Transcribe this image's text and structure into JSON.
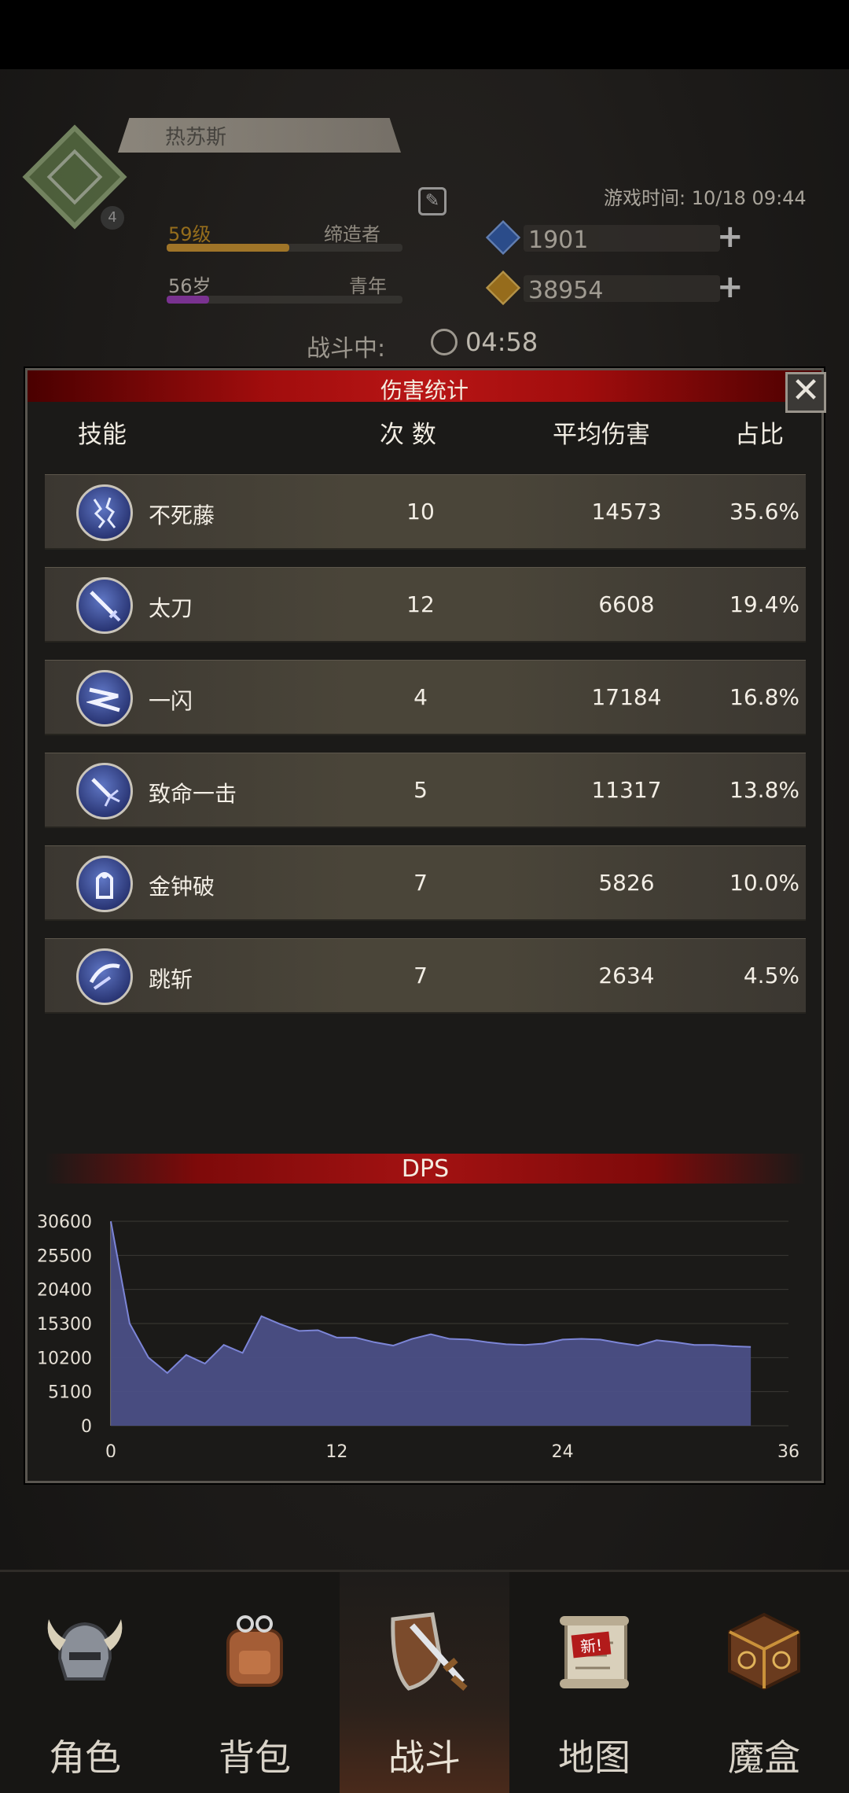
{
  "header": {
    "player_name": "热苏斯",
    "level_text": "59级",
    "title_text": "缔造者",
    "age_text": "56岁",
    "age_stage": "青年",
    "game_time_label": "游戏时间:",
    "game_time_value": "10/18 09:44",
    "gems": "1901",
    "gold": "38954",
    "battle_label": "战斗中:",
    "battle_timer": "04:58",
    "emblem_badge": "4"
  },
  "modal": {
    "title": "伤害统计",
    "close_glyph": "✕",
    "columns": {
      "skill": "技能",
      "count": "次 数",
      "avg": "平均伤害",
      "ratio": "占比"
    },
    "rows": [
      {
        "name": "不死藤",
        "count": "10",
        "avg": "14573",
        "ratio": "35.6%",
        "icon": "vine-lightning-icon"
      },
      {
        "name": "太刀",
        "count": "12",
        "avg": "6608",
        "ratio": "19.4%",
        "icon": "katana-icon"
      },
      {
        "name": "一闪",
        "count": "4",
        "avg": "17184",
        "ratio": "16.8%",
        "icon": "flash-strike-icon"
      },
      {
        "name": "致命一击",
        "count": "5",
        "avg": "11317",
        "ratio": "13.8%",
        "icon": "critical-strike-icon"
      },
      {
        "name": "金钟破",
        "count": "7",
        "avg": "5826",
        "ratio": "10.0%",
        "icon": "golden-bell-break-icon"
      },
      {
        "name": "跳斩",
        "count": "7",
        "avg": "2634",
        "ratio": "4.5%",
        "icon": "leap-slash-icon"
      }
    ],
    "dps_title": "DPS"
  },
  "chart_data": {
    "type": "area",
    "title": "DPS",
    "xlabel": "",
    "ylabel": "",
    "xlim": [
      0,
      36
    ],
    "ylim": [
      0,
      30600
    ],
    "x_ticks": [
      0,
      12,
      24,
      36
    ],
    "y_ticks": [
      0,
      5100,
      10200,
      15300,
      20400,
      25500,
      30600
    ],
    "grid": true,
    "series": [
      {
        "color": "#4b4f86",
        "x": [
          0,
          1,
          2,
          3,
          4,
          5,
          6,
          7,
          8,
          9,
          10,
          11,
          12,
          13,
          14,
          15,
          16,
          17,
          18,
          19,
          20,
          21,
          22,
          23,
          24,
          25,
          26,
          27,
          28,
          29,
          30,
          31,
          32,
          33,
          34
        ],
        "y": [
          30600,
          15300,
          10200,
          7900,
          10600,
          9300,
          12100,
          10900,
          16400,
          15200,
          14200,
          14300,
          13200,
          13200,
          12500,
          12000,
          13000,
          13700,
          13000,
          12900,
          12500,
          12200,
          12100,
          12300,
          12900,
          13000,
          12900,
          12400,
          12000,
          12800,
          12500,
          12100,
          12100,
          11900,
          11800
        ]
      }
    ]
  },
  "bottom_nav": [
    {
      "label": "角色",
      "icon": "viking-helmet-icon"
    },
    {
      "label": "背包",
      "icon": "backpack-icon"
    },
    {
      "label": "战斗",
      "icon": "shield-sword-icon"
    },
    {
      "label": "地图",
      "icon": "map-scroll-icon",
      "badge": "新!"
    },
    {
      "label": "魔盒",
      "icon": "magic-box-icon"
    }
  ],
  "colors": {
    "title_red": "#b81515",
    "row_bg": "#4a4539",
    "area_fill": "#4b4f86",
    "area_line": "#7c85d6",
    "level_bar": "#d69a2e",
    "age_bar": "#a03bc2"
  }
}
